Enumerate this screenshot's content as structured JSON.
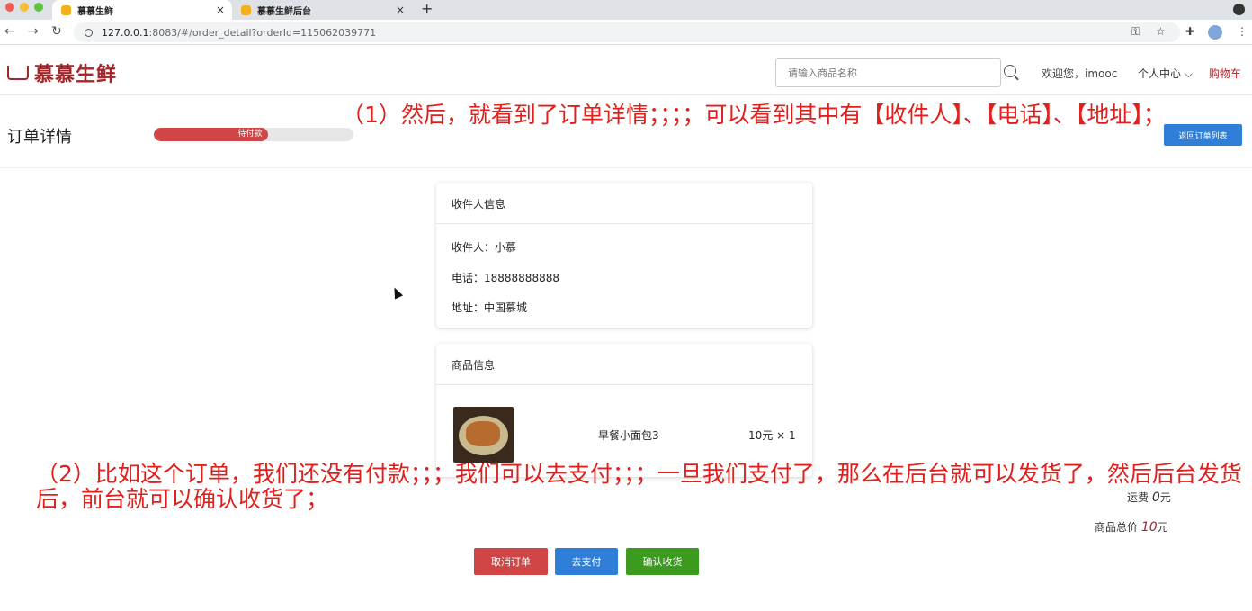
{
  "browser": {
    "tabs": [
      {
        "title": "慕慕生鲜",
        "active": true
      },
      {
        "title": "慕慕生鲜后台",
        "active": false
      }
    ],
    "new_tab": "+",
    "close": "×",
    "url_host": "127.0.0.1",
    "url_path": ":8083/#/order_detail?orderId=115062039771"
  },
  "header": {
    "logo": "慕慕生鲜",
    "search_placeholder": "请输入商品名称",
    "welcome": "欢迎您，imooc",
    "user_center": "个人中心 ⌵",
    "cart": "购物车"
  },
  "order": {
    "title": "订单详情",
    "status": "待付款",
    "status_progress": 0.57,
    "back_label": "返回订单列表"
  },
  "receiver": {
    "heading": "收件人信息",
    "name": "收件人：小慕",
    "phone": "电话：18888888888",
    "address": "地址：中国慕城"
  },
  "goods": {
    "heading": "商品信息",
    "name": "早餐小面包3",
    "price": "10元 × 1"
  },
  "summary": {
    "shipping_label": "运费",
    "shipping_value": "0",
    "shipping_unit": "元",
    "total_label": "商品总价",
    "total_value": "10",
    "total_unit": "元"
  },
  "actions": {
    "cancel": "取消订单",
    "pay": "去支付",
    "confirm": "确认收货"
  },
  "annotations": {
    "first": "（1）然后，就看到了订单详情；；；；可以看到其中有【收件人】、【电话】、【地址】；",
    "second": "（2）比如这个订单，我们还没有付款；；；我们可以去支付；；；一旦我们支付了，那么在后台就可以发货了，然后后台发货后，前台就可以确认收货了；"
  },
  "colors": {
    "brand": "#a2262a",
    "annotation": "#e0201c",
    "pay": "#2f7fd8",
    "cancel": "#d04545",
    "confirm": "#3c9a1e"
  }
}
